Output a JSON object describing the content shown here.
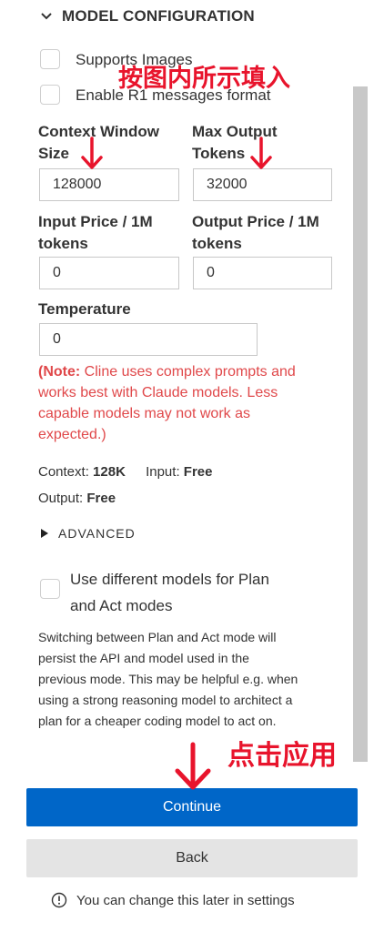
{
  "section": {
    "title": "MODEL CONFIGURATION"
  },
  "checkboxes": {
    "supports_images": "Supports Images",
    "enable_r1": "Enable R1 messages format"
  },
  "fields": {
    "context_window": {
      "label_line1": "Context Window",
      "label_line2": "Size",
      "value": "128000"
    },
    "max_output": {
      "label_line1": "Max Output",
      "label_line2": "Tokens",
      "value": "32000"
    },
    "input_price": {
      "label_line1": "Input Price / 1M",
      "label_line2": "tokens",
      "value": "0"
    },
    "output_price": {
      "label_line1": "Output Price / 1M",
      "label_line2": "tokens",
      "value": "0"
    },
    "temperature": {
      "label": "Temperature",
      "value": "0"
    }
  },
  "note": {
    "prefix": "(Note:",
    "line1": " Cline uses complex prompts and",
    "line2": "works best with Claude models. Less",
    "line3": "capable models may not work as",
    "line4": "expected.)"
  },
  "summary": {
    "context_label": "Context:",
    "context_value": "128K",
    "input_label": "Input:",
    "input_value": "Free",
    "output_label": "Output:",
    "output_value": "Free"
  },
  "advanced": {
    "label": "ADVANCED"
  },
  "plan_act": {
    "line1": "Use different models for Plan",
    "line2": "and Act modes"
  },
  "description": {
    "line1": "Switching between Plan and Act mode will",
    "line2": "persist the API and model used in the",
    "line3": "previous mode. This may be helpful e.g. when",
    "line4": "using a strong reasoning model to architect a",
    "line5": "plan for a cheaper coding model to act on."
  },
  "buttons": {
    "continue": "Continue",
    "back": "Back"
  },
  "hint": {
    "text": "You can change this later in settings"
  },
  "annotations": {
    "fill_in": "按图内所示填入",
    "click_apply": "点击应用",
    "color": "#e8142c"
  },
  "colors": {
    "accent": "#0066c8",
    "note": "#e0484a"
  }
}
